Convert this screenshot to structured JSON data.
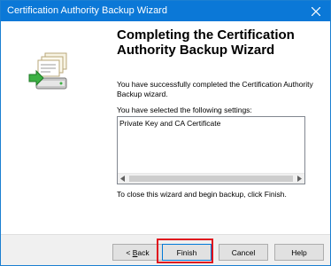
{
  "window": {
    "title": "Certification Authority Backup Wizard"
  },
  "header": {
    "heading": "Completing the Certification Authority Backup Wizard"
  },
  "content": {
    "success_text": "You have successfully completed the Certification Authority Backup wizard.",
    "settings_label": "You have selected the following settings:",
    "settings_items": [
      "Private Key and CA Certificate"
    ],
    "close_instruction": "To close this wizard and begin backup, click Finish."
  },
  "buttons": {
    "back_prefix": "< ",
    "back_mnemonic": "B",
    "back_rest": "ack",
    "finish": "Finish",
    "cancel": "Cancel",
    "help": "Help"
  },
  "icons": {
    "close": "close-icon",
    "wizard_graphic": "certificate-backup-icon",
    "scroll_left": "scroll-left-icon",
    "scroll_right": "scroll-right-icon"
  },
  "colors": {
    "titlebar": "#0b78d7",
    "highlight": "#e0141e",
    "default_button_border": "#0078d7"
  }
}
